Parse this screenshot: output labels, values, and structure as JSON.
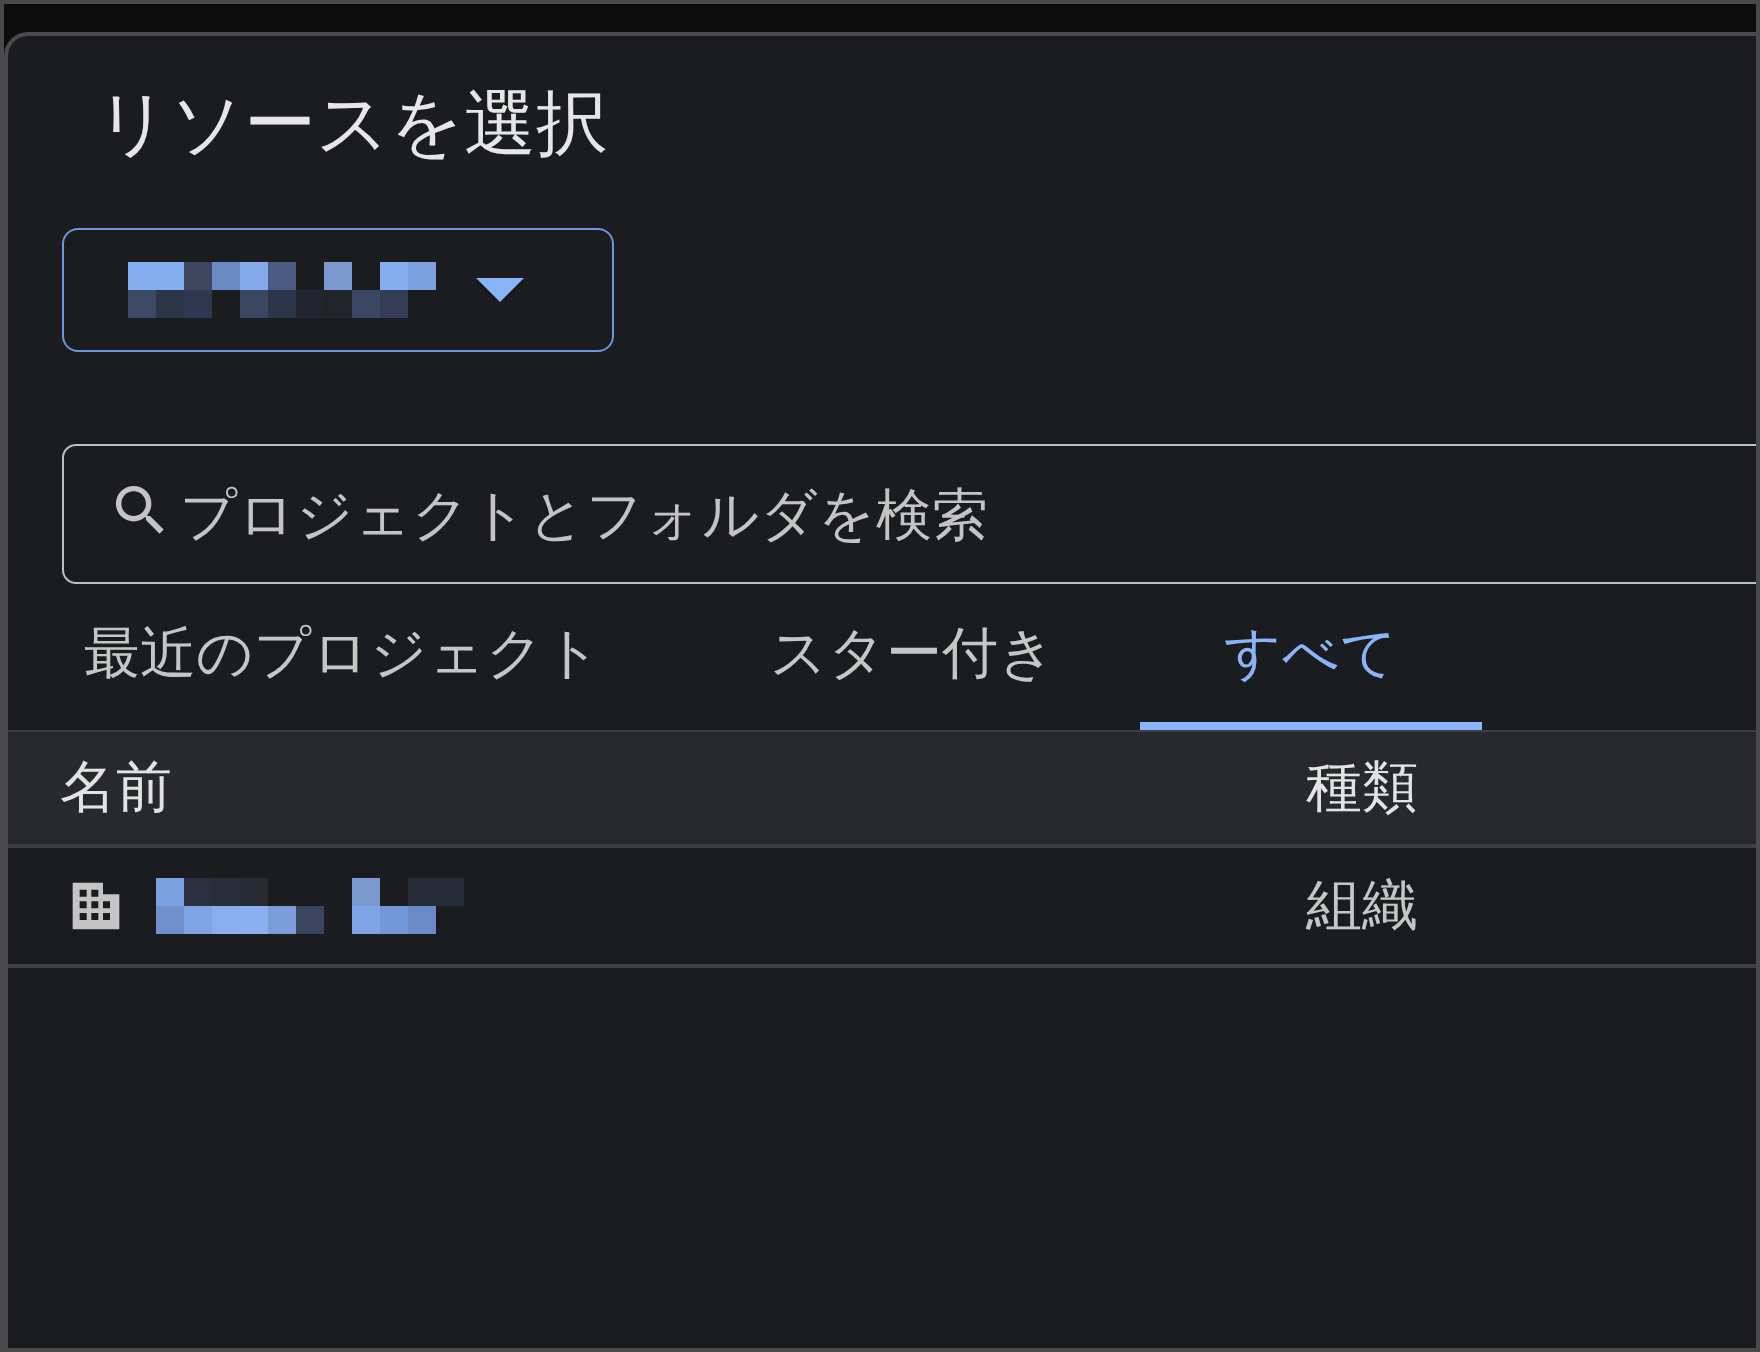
{
  "dialog": {
    "title": "リソースを選択",
    "search": {
      "placeholder": "プロジェクトとフォルダを検索"
    },
    "tabs": [
      {
        "label": "最近のプロジェクト",
        "selected": false
      },
      {
        "label": "スター付き",
        "selected": false
      },
      {
        "label": "すべて",
        "selected": true
      }
    ],
    "table": {
      "columns": [
        "名前",
        "種類"
      ],
      "rows": [
        {
          "kind": "organization",
          "category": "組織"
        }
      ]
    }
  }
}
